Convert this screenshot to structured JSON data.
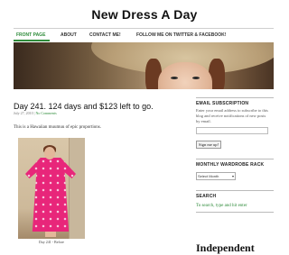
{
  "site": {
    "title": "New Dress A Day"
  },
  "nav": {
    "items": [
      {
        "label": "FRONT PAGE",
        "active": true
      },
      {
        "label": "ABOUT",
        "active": false
      },
      {
        "label": "CONTACT ME!",
        "active": false
      },
      {
        "label": "FOLLOW ME ON TWITTER & FACEBOOK!",
        "active": false
      }
    ]
  },
  "post": {
    "title": "Day 241. 124 days and $123 left to go.",
    "date": "July 27, 2010",
    "comments": "No Comments",
    "body": "This is a Hawaiian muumuu of epic proportions.",
    "photo_caption": "Day 241 - Before"
  },
  "sidebar": {
    "email": {
      "title": "EMAIL SUBSCRIPTION",
      "text": "Enter your email address to subscribe to this blog and receive notifications of new posts by email.",
      "button": "Sign me up!"
    },
    "archive": {
      "title": "MONTHLY WARDROBE RACK",
      "select": "Select Month"
    },
    "search": {
      "title": "SEARCH",
      "hint": "To search, type and hit enter"
    },
    "badge": "Independent"
  },
  "colors": {
    "accent": "#2e8b3a",
    "dress": "#e8267a"
  }
}
